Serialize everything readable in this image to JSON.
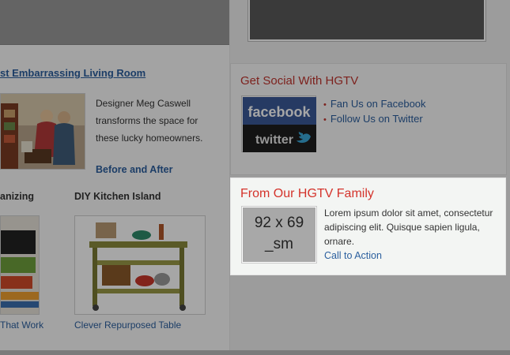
{
  "colors": {
    "link": "#2b5f9e",
    "accent_red": "#d4332b",
    "overlay": "rgba(0,0,0,0.35)"
  },
  "left": {
    "feature": {
      "title": "st Embarrassing Living Room",
      "description": "Designer Meg Caswell transforms the space for these lucky homeowners.",
      "link": "Before and After"
    },
    "subfeatures": [
      {
        "title": "anizing",
        "link": "That Work"
      },
      {
        "title": "DIY Kitchen Island",
        "link": "Clever Repurposed Table"
      }
    ]
  },
  "right": {
    "social": {
      "title": "Get Social With HGTV",
      "logo_top": "facebook",
      "logo_bottom": "twitter",
      "links": [
        "Fan Us on Facebook",
        "Follow Us on Twitter"
      ]
    },
    "family": {
      "title": "From Our HGTV Family",
      "thumb_line1": "92 x 69",
      "thumb_line2": "_sm",
      "text": "Lorem ipsum dolor sit amet, consectetur adipiscing elit. Quisque sapien ligula, ornare.",
      "cta": "Call to Action"
    }
  }
}
